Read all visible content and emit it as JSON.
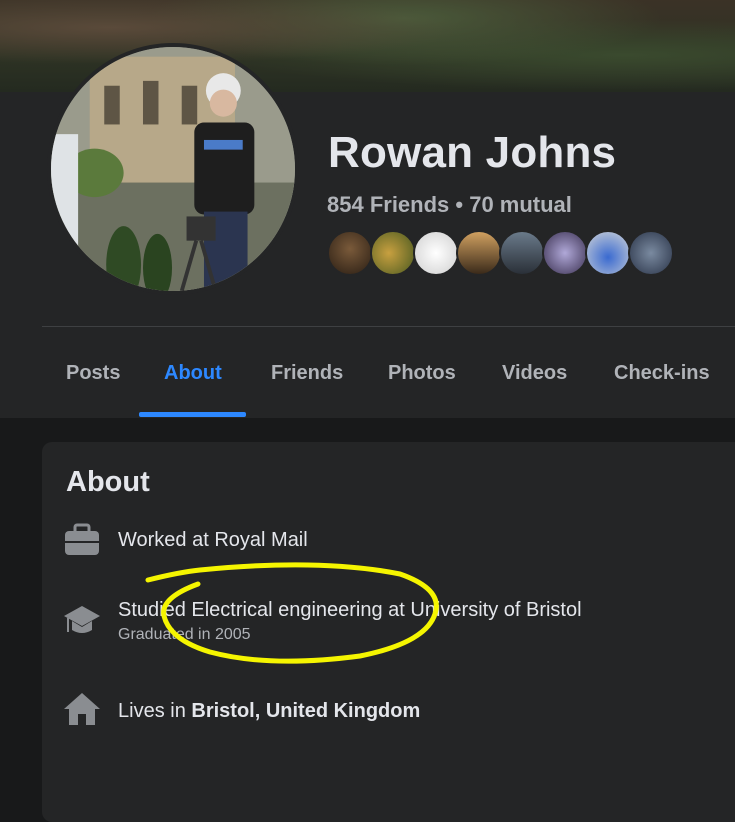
{
  "profile": {
    "name": "Rowan Johns",
    "friends_summary": "854 Friends • 70 mutual",
    "mutual_friend_avatars": [
      "friend-avatar",
      "friend-avatar",
      "friend-avatar",
      "friend-avatar",
      "friend-avatar",
      "friend-avatar",
      "friend-avatar",
      "friend-avatar"
    ]
  },
  "tabs": [
    {
      "label": "Posts",
      "active": false
    },
    {
      "label": "About",
      "active": true
    },
    {
      "label": "Friends",
      "active": false
    },
    {
      "label": "Photos",
      "active": false
    },
    {
      "label": "Videos",
      "active": false
    },
    {
      "label": "Check-ins",
      "active": false
    }
  ],
  "about": {
    "title": "About",
    "work": {
      "icon": "briefcase-icon",
      "text": "Worked at Royal Mail"
    },
    "education": {
      "icon": "graduation-cap-icon",
      "text": "Studied Electrical engineering at University of Bristol",
      "subtext": "Graduated in 2005"
    },
    "residence": {
      "icon": "home-icon",
      "prefix": "Lives in ",
      "place": "Bristol, United Kingdom"
    }
  },
  "annotation": {
    "color": "#f5f500",
    "type": "hand-drawn-ellipse"
  },
  "colors": {
    "accent": "#2d88ff",
    "background": "#18191a",
    "panel": "#242526",
    "secondary_text": "#b0b3b8"
  }
}
